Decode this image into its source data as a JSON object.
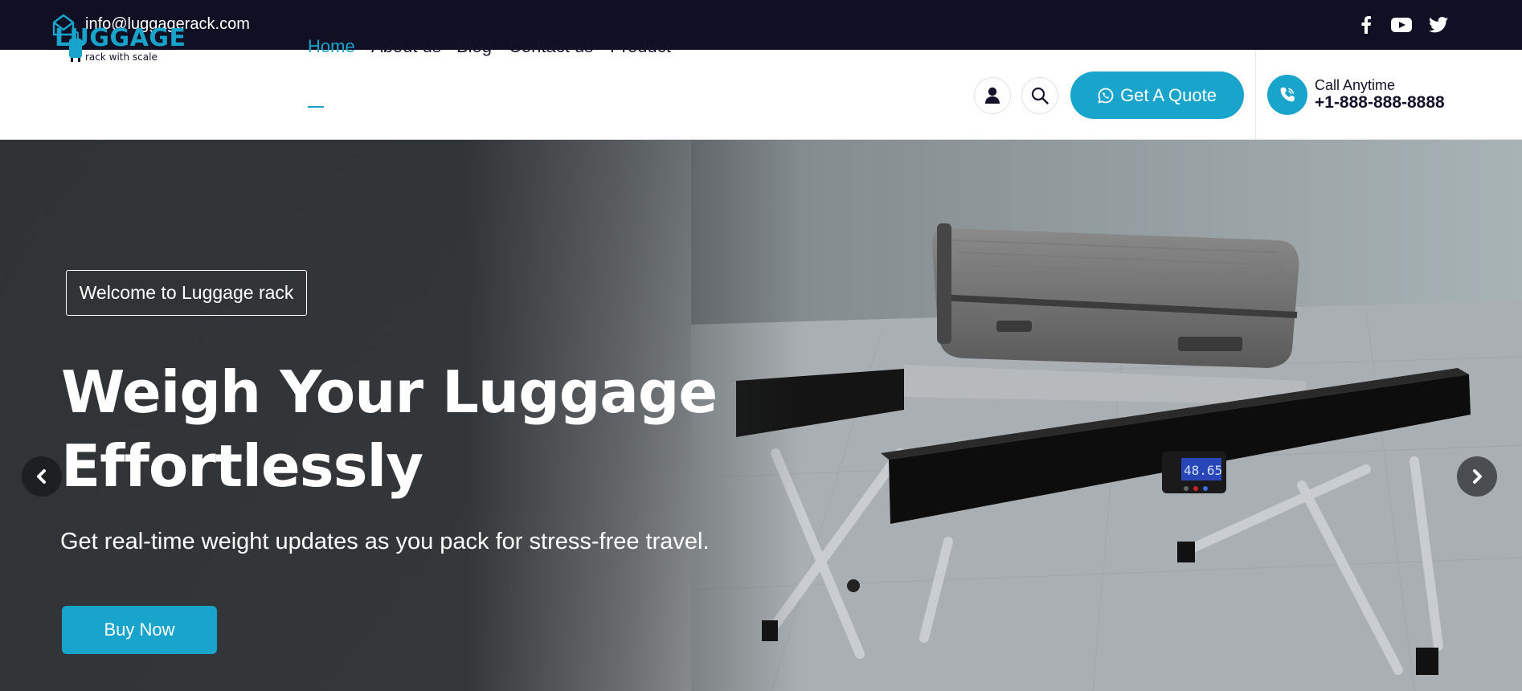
{
  "topbar": {
    "email": "info@luggagerack.com",
    "icons": [
      "mail-icon",
      "facebook-icon",
      "youtube-icon",
      "twitter-icon"
    ]
  },
  "brand": {
    "logo_word": "LUGGAGE",
    "logo_tagline": "rack with scale",
    "accent_color": "#19a4cc",
    "dark_color": "#100f24"
  },
  "nav": {
    "items": [
      {
        "label": "Home",
        "active": true
      },
      {
        "label": "About us",
        "active": false
      },
      {
        "label": "Blog",
        "active": false
      },
      {
        "label": "Contact us",
        "active": false
      },
      {
        "label": "Product",
        "active": false
      }
    ]
  },
  "header_actions": {
    "icons": [
      "user-icon",
      "search-icon",
      "whatsapp-icon",
      "phone-icon"
    ],
    "quote_label": "Get A Quote",
    "call_label": "Call Anytime",
    "call_number": "+1-888-888-8888"
  },
  "hero": {
    "badge": "Welcome to Luggage rack",
    "headline_line1": "Weigh Your Luggage",
    "headline_line2": "Effortlessly",
    "subline": "Get real-time weight updates as you pack for stress-free travel.",
    "cta_label": "Buy Now",
    "scale_display": "48.65",
    "arrows": [
      "chevron-left-icon",
      "chevron-right-icon"
    ]
  }
}
